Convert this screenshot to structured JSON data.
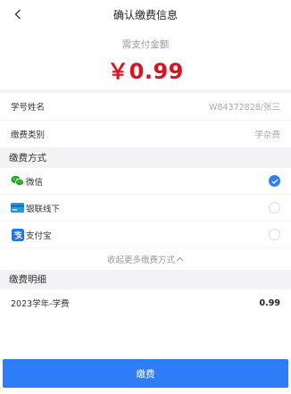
{
  "nav": {
    "title": "确认缴费信息",
    "back_icon": "chevron-left-icon"
  },
  "amount": {
    "label": "需支付金额",
    "value": "￥0.99",
    "color": "#e0101f"
  },
  "info": [
    {
      "label": "学号姓名",
      "value": "W84372828/张三"
    },
    {
      "label": "缴费类别",
      "value": "学杂费"
    }
  ],
  "payment": {
    "section_title": "缴费方式",
    "methods": [
      {
        "label": "微信",
        "icon": "wechat-icon",
        "selected": true
      },
      {
        "label": "银联线下",
        "icon": "unionpay-card-icon",
        "selected": false
      },
      {
        "label": "支付宝",
        "icon": "alipay-icon",
        "selected": false
      }
    ],
    "collapse_label": "收起更多缴费方式"
  },
  "details": {
    "section_title": "缴费明细",
    "items": [
      {
        "name": "2023学年-学费",
        "amount": "0.99"
      }
    ]
  },
  "submit": {
    "label": "缴费",
    "color": "#2f7df6"
  }
}
